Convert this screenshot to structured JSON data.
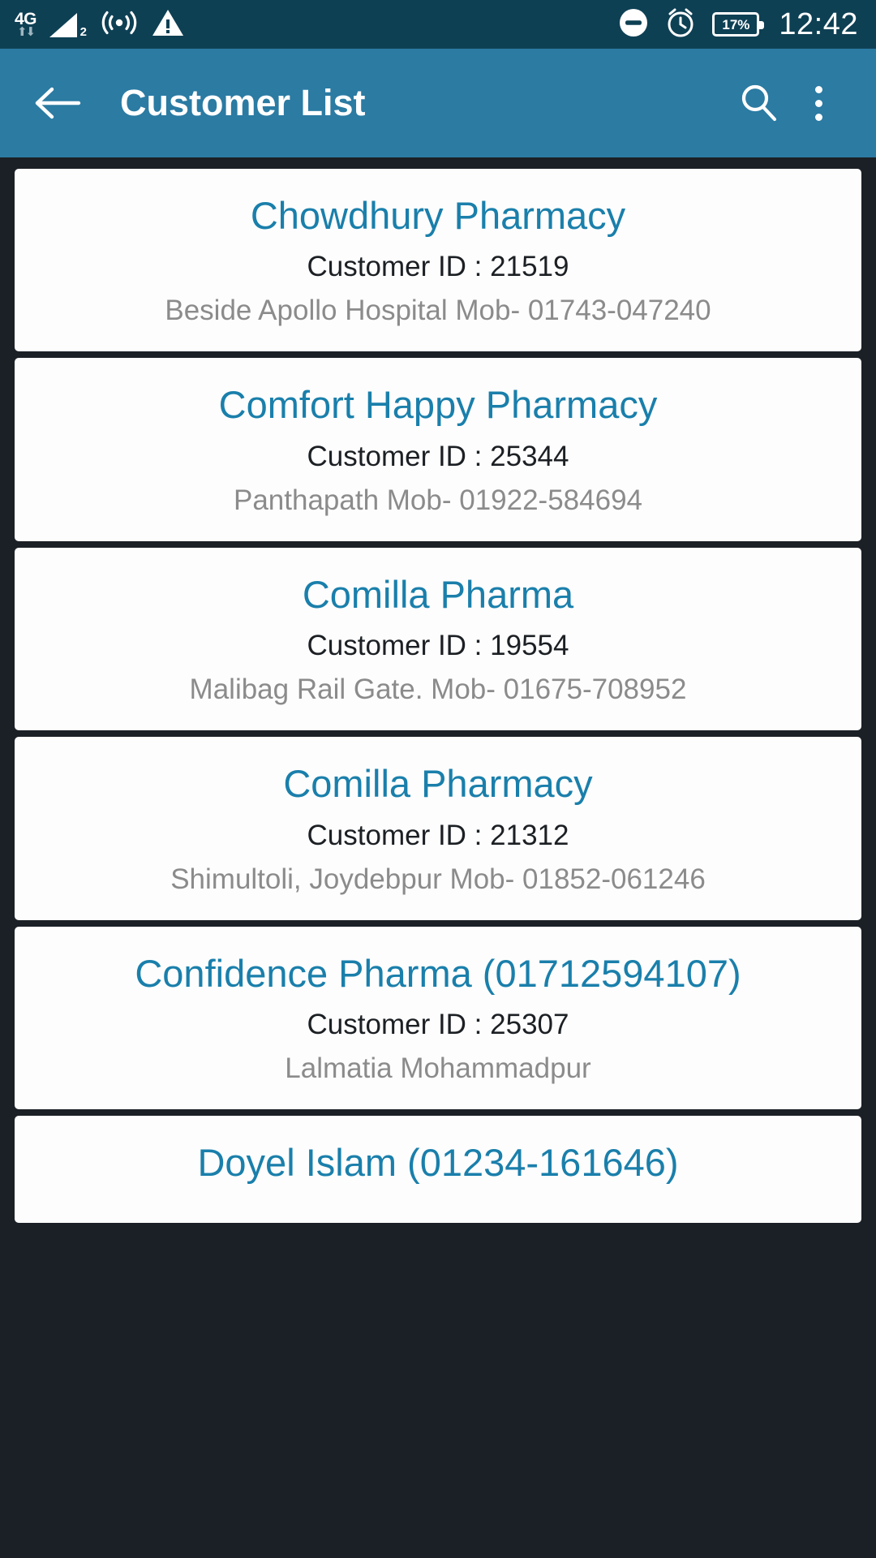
{
  "status_bar": {
    "network_type": "4G",
    "signal_sim": "2",
    "icons": [
      "4g-data-icon",
      "signal-bars-icon",
      "hotspot-icon",
      "warning-triangle-icon",
      "do-not-disturb-icon",
      "alarm-clock-icon",
      "battery-icon"
    ],
    "battery_percent": "17%",
    "time": "12:42",
    "background_color": "#0e4054"
  },
  "app_bar": {
    "title": "Customer List",
    "back_icon": "arrow-left-icon",
    "search_icon": "search-icon",
    "overflow_icon": "more-vertical-icon",
    "background_color": "#2b7ba3"
  },
  "theme": {
    "accent_color": "#1a7fab",
    "page_background": "#1b2026",
    "card_background": "#fdfdfd",
    "id_text_color": "#1c2024",
    "address_text_color": "#8b8b8b"
  },
  "customer_list": {
    "id_label_prefix": "Customer ID : ",
    "items": [
      {
        "name": "Chowdhury Pharmacy",
        "id_line": "Customer ID : 21519",
        "customer_id": "21519",
        "address": "Beside Apollo Hospital Mob- 01743-047240"
      },
      {
        "name": "Comfort Happy Pharmacy",
        "id_line": "Customer ID : 25344",
        "customer_id": "25344",
        "address": "Panthapath Mob- 01922-584694"
      },
      {
        "name": "Comilla Pharma",
        "id_line": "Customer ID : 19554",
        "customer_id": "19554",
        "address": "Malibag Rail Gate. Mob- 01675-708952"
      },
      {
        "name": "Comilla Pharmacy",
        "id_line": "Customer ID : 21312",
        "customer_id": "21312",
        "address": "Shimultoli, Joydebpur Mob- 01852-061246"
      },
      {
        "name": "Confidence Pharma (01712594107)",
        "id_line": "Customer ID : 25307",
        "customer_id": "25307",
        "address": "Lalmatia Mohammadpur"
      },
      {
        "name": "Doyel Islam (01234-161646)",
        "id_line": "",
        "customer_id": "",
        "address": ""
      }
    ]
  }
}
